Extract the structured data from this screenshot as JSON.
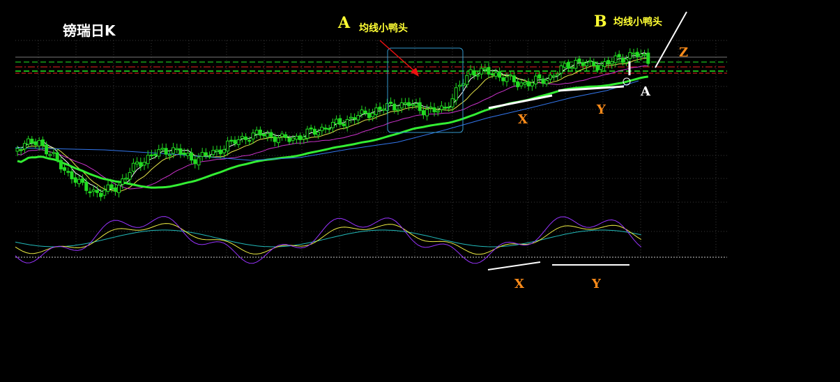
{
  "chart_data": {
    "type": "candlestick",
    "title": "镑瑞日K",
    "annotations": {
      "a_top": "A",
      "a_top_text": "均线小鸭头",
      "b_top": "B",
      "b_top_text": "均线小鸭头",
      "z": "Z",
      "a_right": "A",
      "x_price": "X",
      "y_price": "Y",
      "x_osc": "X",
      "y_osc": "Y"
    },
    "colors": {
      "candle": "#22dd22",
      "ma_short": "#ffffff",
      "ma_mid": "#e8e84a",
      "ma_long": "#cc33cc",
      "ma_main": "#33ee33",
      "ma_slow": "#3377ee",
      "osc_purple": "#9933ff",
      "osc_yellow": "#eeee44",
      "osc_cyan": "#22bbbb",
      "box": "#3399cc",
      "arrow": "#ee1111",
      "hline_green": "#22ee22",
      "hline_red": "#ee2222",
      "hline_gray": "#777777"
    }
  }
}
